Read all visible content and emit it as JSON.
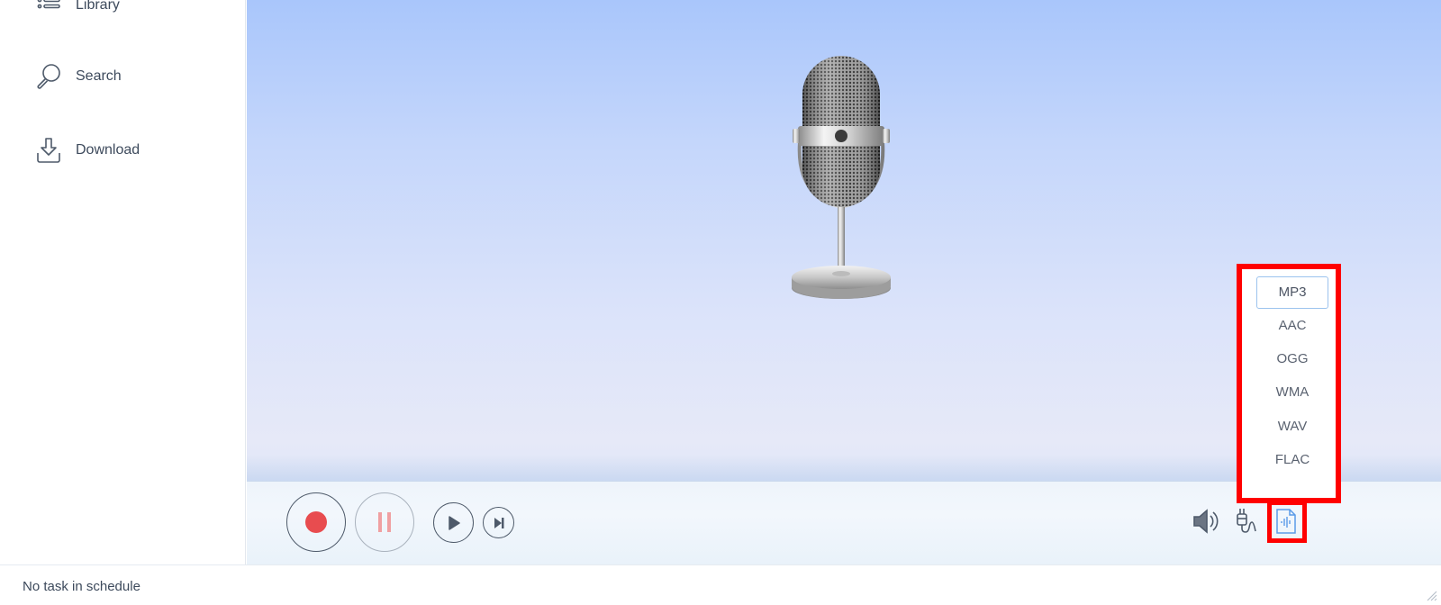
{
  "sidebar": {
    "items": [
      {
        "label": "Library",
        "icon": "library-list-icon"
      },
      {
        "label": "Search",
        "icon": "search-icon"
      },
      {
        "label": "Download",
        "icon": "download-icon"
      }
    ]
  },
  "recorder": {
    "controls": [
      {
        "name": "record",
        "icon": "record-icon"
      },
      {
        "name": "pause",
        "icon": "pause-icon",
        "enabled": false
      },
      {
        "name": "play",
        "icon": "play-icon"
      },
      {
        "name": "skip-next",
        "icon": "skip-next-icon"
      }
    ],
    "tools": [
      {
        "name": "volume",
        "icon": "speaker-icon"
      },
      {
        "name": "audio-input",
        "icon": "audio-cable-icon"
      },
      {
        "name": "output-format",
        "icon": "audio-file-icon",
        "highlighted": true
      }
    ],
    "colors": {
      "record": "#e84c4f",
      "highlight": "#ff0000",
      "format_icon": "#5b9be8"
    }
  },
  "format_menu": {
    "selected": "MP3",
    "options": [
      "MP3",
      "AAC",
      "OGG",
      "WMA",
      "WAV",
      "FLAC"
    ]
  },
  "status": {
    "text": "No task in schedule"
  }
}
